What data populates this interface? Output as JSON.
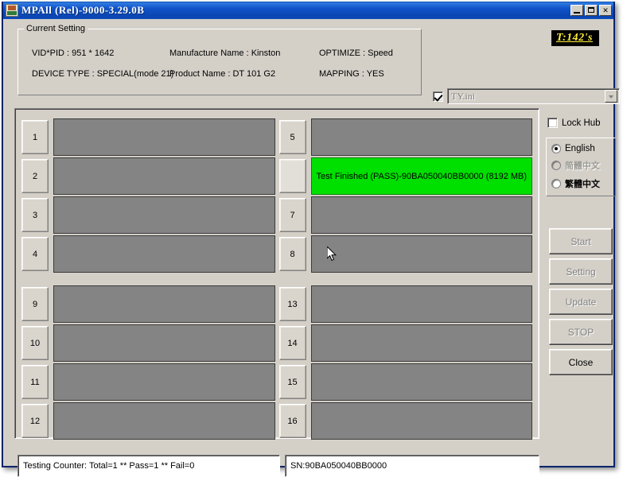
{
  "window": {
    "title": "MPAll (Rel)-9000-3.29.0B",
    "minimize_label": "",
    "maximize_label": "",
    "close_label": "✕"
  },
  "current_setting": {
    "group_title": "Current Setting",
    "vid_pid": "VID*PID :  951 * 1642",
    "device_type": "DEVICE TYPE : SPECIAL(mode 21)",
    "manufacture_name": "Manufacture Name : Kinston",
    "product_name": "Product Name : DT 101 G2",
    "optimize": "OPTIMIZE : Speed",
    "mapping": "MAPPING : YES"
  },
  "timer": {
    "label": "T:142's"
  },
  "ini": {
    "selected": "TY.ini",
    "checked": true
  },
  "ports": {
    "col1_top": [
      {
        "number": "1",
        "status": "",
        "state": "idle"
      },
      {
        "number": "2",
        "status": "",
        "state": "idle"
      },
      {
        "number": "3",
        "status": "",
        "state": "idle"
      },
      {
        "number": "4",
        "status": "",
        "state": "idle"
      }
    ],
    "col2_top": [
      {
        "number": "5",
        "status": "",
        "state": "idle"
      },
      {
        "number": "",
        "status": "Test Finished (PASS)-90BA050040BB0000 (8192 MB)",
        "state": "pass"
      },
      {
        "number": "7",
        "status": "",
        "state": "idle"
      },
      {
        "number": "8",
        "status": "",
        "state": "idle"
      }
    ],
    "col1_bottom": [
      {
        "number": "9",
        "status": "",
        "state": "idle"
      },
      {
        "number": "10",
        "status": "",
        "state": "idle"
      },
      {
        "number": "11",
        "status": "",
        "state": "idle"
      },
      {
        "number": "12",
        "status": "",
        "state": "idle"
      }
    ],
    "col2_bottom": [
      {
        "number": "13",
        "status": "",
        "state": "idle"
      },
      {
        "number": "14",
        "status": "",
        "state": "idle"
      },
      {
        "number": "15",
        "status": "",
        "state": "idle"
      },
      {
        "number": "16",
        "status": "",
        "state": "idle"
      }
    ]
  },
  "side": {
    "lock_hub_label": "Lock Hub",
    "lock_hub_checked": false,
    "languages": [
      {
        "label": "English",
        "selected": true,
        "disabled": false
      },
      {
        "label": "简體中文",
        "selected": false,
        "disabled": true
      },
      {
        "label": "繁體中文",
        "selected": false,
        "disabled": false
      }
    ],
    "buttons": [
      {
        "label": "Start",
        "disabled": true
      },
      {
        "label": "Setting",
        "disabled": true
      },
      {
        "label": "Update",
        "disabled": true
      },
      {
        "label": "STOP",
        "disabled": true
      },
      {
        "label": "Close",
        "disabled": false
      }
    ]
  },
  "status": {
    "counter": "Testing Counter: Total=1 ** Pass=1 ** Fail=0",
    "serial": "SN:90BA050040BB0000"
  },
  "colors": {
    "pass_green": "#00e000",
    "idle_gray": "#848484",
    "face": "#d4d0c8",
    "titlebar_blue": "#0a44b0",
    "timer_yellow": "#ffee33"
  }
}
